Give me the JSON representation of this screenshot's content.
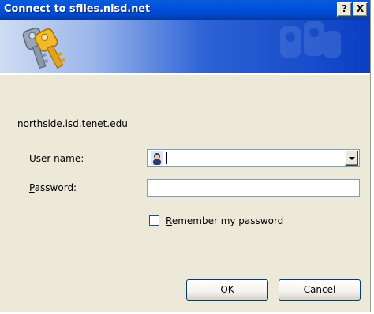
{
  "window": {
    "title": "Connect to sfiles.nisd.net",
    "help_label": "?",
    "close_label": "X"
  },
  "banner": {
    "icon": "keys-icon"
  },
  "server": {
    "text": "northside.isd.tenet.edu"
  },
  "username": {
    "label_mnemonic": "U",
    "label_rest": "ser name:",
    "value": "",
    "icon": "user-avatar-icon"
  },
  "password": {
    "label_mnemonic": "P",
    "label_rest": "assword:",
    "value": ""
  },
  "remember": {
    "label_mnemonic": "R",
    "label_rest": "emember my password",
    "checked": false
  },
  "buttons": {
    "ok": "OK",
    "cancel": "Cancel"
  },
  "colors": {
    "titlebar": "#0054e3",
    "dialog_bg": "#ece9d8",
    "key_gold": "#e0a41c",
    "key_silver": "#8b97a8"
  }
}
